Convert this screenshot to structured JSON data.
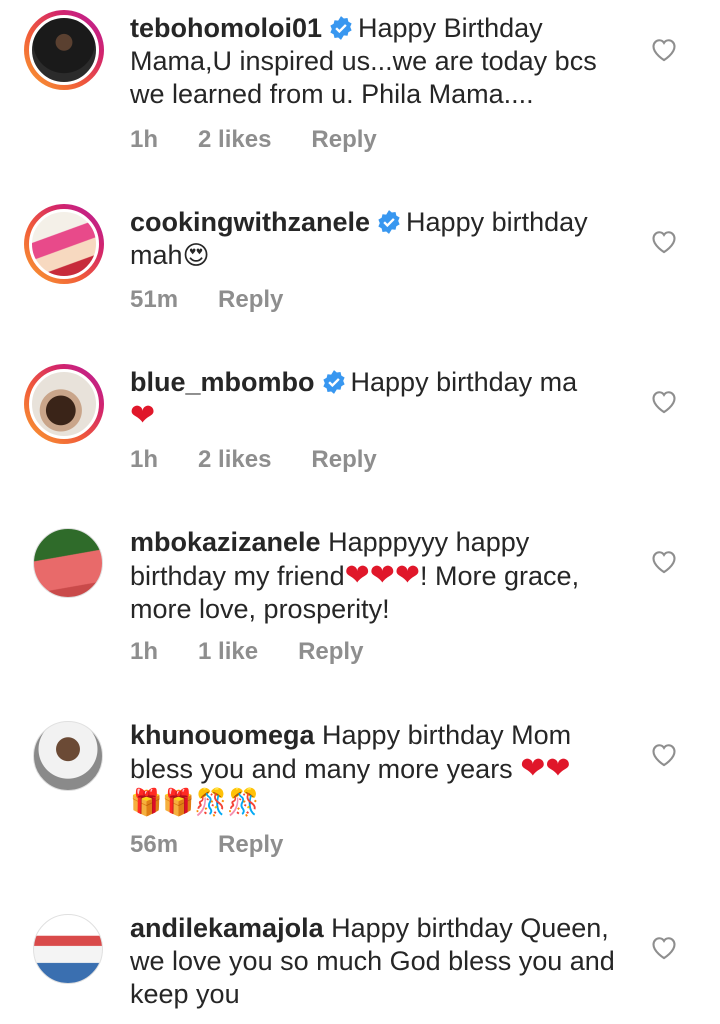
{
  "comments": [
    {
      "username": "tebohomoloi01",
      "verified": true,
      "text": "Happy Birthday Mama,U inspired us...we are today bcs we learned from u. Phila Mama....",
      "time": "1h",
      "likes": "2 likes",
      "reply": "Reply"
    },
    {
      "username": "cookingwithzanele",
      "verified": true,
      "text": "Happy birthday mah",
      "emoji": "😍",
      "time": "51m",
      "reply": "Reply"
    },
    {
      "username": "blue_mbombo",
      "verified": true,
      "text": "Happy birthday ma",
      "emoji": "❤",
      "time": "1h",
      "likes": "2 likes",
      "reply": "Reply"
    },
    {
      "username": "mbokazizanele",
      "verified": false,
      "text_a": "Happpyyy happy birthday my friend",
      "emoji": "❤❤❤",
      "text_b": "! More grace, more love, prosperity!",
      "time": "1h",
      "likes": "1 like",
      "reply": "Reply"
    },
    {
      "username": "khunouomega",
      "verified": false,
      "text": "Happy birthday Mom bless you and many more years",
      "emoji": "❤❤",
      "emoji2": "🎁🎁🎊🎊",
      "time": "56m",
      "reply": "Reply"
    },
    {
      "username": "andilekamajola",
      "verified": false,
      "text": "Happy birthday Queen, we love you so much God bless you and keep you"
    }
  ],
  "colors": {
    "verified_blue": "#3897f0",
    "meta_gray": "#8e8e8e",
    "heart_red": "#e0172a",
    "story_ring": "#d3256b"
  },
  "icons": {
    "like": "heart-outline-icon",
    "verified": "verified-badge-icon"
  }
}
